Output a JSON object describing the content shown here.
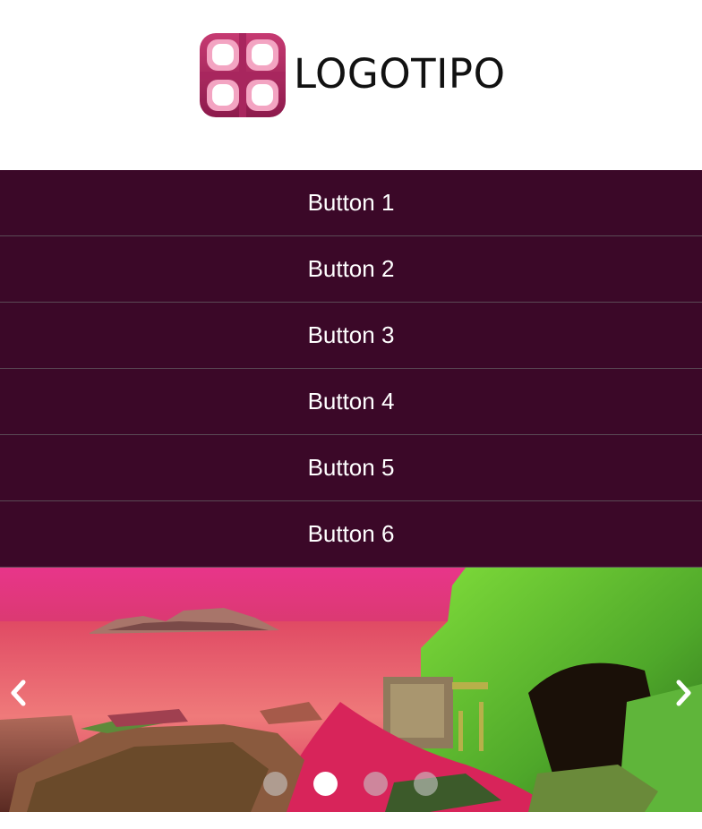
{
  "header": {
    "logo_text": "LOGOTIPO",
    "logo_icon": "four-petal-logo-icon"
  },
  "nav": {
    "buttons": [
      {
        "label": "Button 1"
      },
      {
        "label": "Button 2"
      },
      {
        "label": "Button 3"
      },
      {
        "label": "Button 4"
      },
      {
        "label": "Button 5"
      },
      {
        "label": "Button 6"
      }
    ]
  },
  "slider": {
    "prev_icon": "chevron-left-icon",
    "next_icon": "chevron-right-icon",
    "slide_count": 4,
    "active_index": 1
  },
  "colors": {
    "nav_background": "#3b0828",
    "nav_text": "#ffffff",
    "logo_pink": "#e0457f",
    "logo_dark": "#9b1f55"
  }
}
